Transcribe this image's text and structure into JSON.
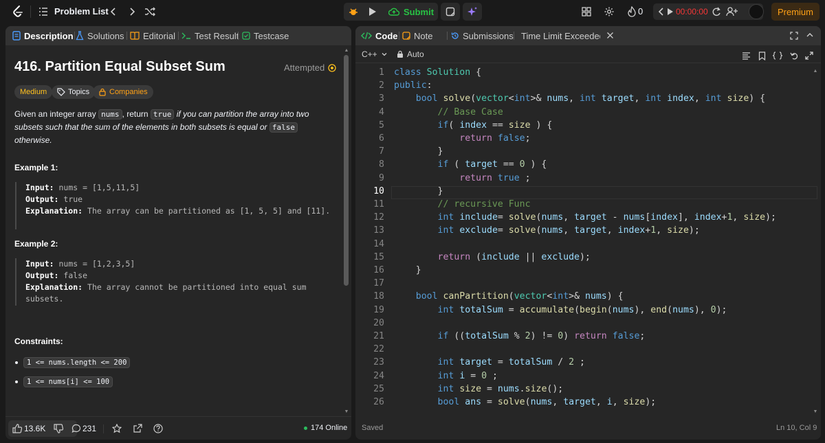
{
  "topbar": {
    "problem_list_label": "Problem List",
    "submit_label": "Submit",
    "streak_count": "0",
    "timer": "00:00:00",
    "premium_label": "Premium"
  },
  "left_tabs": [
    {
      "label": "Description",
      "icon": "description-icon"
    },
    {
      "label": "Solutions",
      "icon": "flask-icon"
    },
    {
      "label": "Editorial",
      "icon": "book-icon"
    },
    {
      "label": "Test Result",
      "icon": "terminal-icon"
    },
    {
      "label": "Testcase",
      "icon": "checkbox-icon"
    }
  ],
  "problem": {
    "title": "416. Partition Equal Subset Sum",
    "status": "Attempted",
    "difficulty": "Medium",
    "topics_label": "Topics",
    "companies_label": "Companies",
    "desc_1": "Given an integer array ",
    "desc_code_1": "nums",
    "desc_2": ", return ",
    "desc_code_2": "true",
    "desc_3": " if you can partition the array into two subsets such that the sum of the elements in both subsets is equal or ",
    "desc_code_3": "false",
    "desc_4": " otherwise.",
    "example1_title": "Example 1:",
    "example1_input_label": "Input:",
    "example1_input": "nums = [1,5,11,5]",
    "example1_output_label": "Output:",
    "example1_output": "true",
    "example1_expl_label": "Explanation:",
    "example1_expl": "The array can be partitioned as [1, 5, 5] and [11].",
    "example2_title": "Example 2:",
    "example2_input_label": "Input:",
    "example2_input": "nums = [1,2,3,5]",
    "example2_output_label": "Output:",
    "example2_output": "false",
    "example2_expl_label": "Explanation:",
    "example2_expl": "The array cannot be partitioned into equal sum subsets.",
    "constraints_title": "Constraints:",
    "constraint_1": "1 <= nums.length <= 200",
    "constraint_2": "1 <= nums[i] <= 100"
  },
  "left_footer": {
    "likes": "13.6K",
    "comments": "231",
    "online": "174 Online"
  },
  "right_tabs": [
    {
      "label": "Code",
      "icon": "code-icon"
    },
    {
      "label": "Note",
      "icon": "note-icon"
    },
    {
      "label": "Submissions",
      "icon": "history-icon"
    },
    {
      "label": "Time Limit Exceeded",
      "icon": "history-icon"
    }
  ],
  "editor": {
    "language": "C++",
    "mode": "Auto",
    "saved_label": "Saved",
    "cursor_position": "Ln 10, Col 9",
    "current_line": 10,
    "lines": [
      "class Solution {",
      "public:",
      "    bool solve(vector<int>& nums, int target, int index, int size) {",
      "        // Base Case",
      "        if( index == size ) {",
      "            return false;",
      "        }",
      "        if ( target == 0 ) {",
      "            return true ;",
      "        }",
      "        // recursive Func",
      "        int include= solve(nums, target - nums[index], index+1, size);",
      "        int exclude= solve(nums, target, index+1, size);",
      "",
      "        return (include || exclude);",
      "    }",
      "",
      "    bool canPartition(vector<int>& nums) {",
      "        int totalSum = accumulate(begin(nums), end(nums), 0);",
      "",
      "        if ((totalSum % 2) != 0) return false;",
      "",
      "        int target = totalSum / 2 ;",
      "        int i = 0 ;",
      "        int size = nums.size();",
      "        bool ans = solve(nums, target, i, size);"
    ]
  }
}
